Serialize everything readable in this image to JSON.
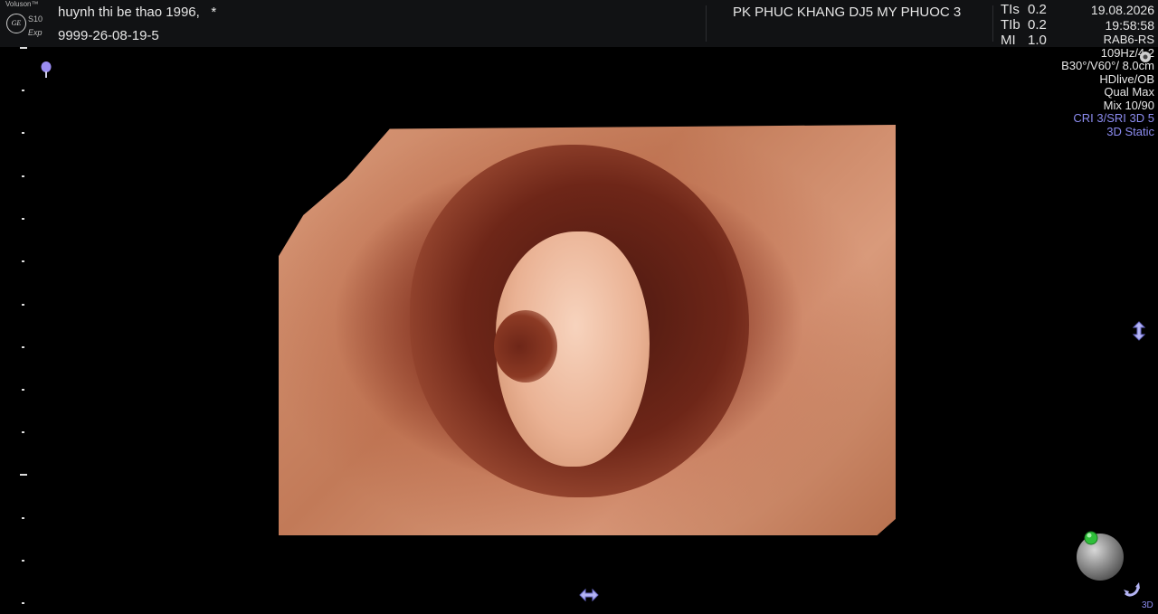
{
  "device": {
    "brand": "Voluson™",
    "logo_text": "GE",
    "model": "S10",
    "edition": "Exp"
  },
  "patient": {
    "name": "huynh thi be thao 1996,",
    "flag": "*",
    "id": "9999-26-08-19-5"
  },
  "hospital": "PK PHUC KHANG DJ5 MY PHUOC 3",
  "indices": [
    {
      "label": "TIs",
      "value": "0.2"
    },
    {
      "label": "TIb",
      "value": "0.2"
    },
    {
      "label": "MI",
      "value": "1.0"
    }
  ],
  "date": "19.08.2026",
  "time": "19:58:58",
  "params": {
    "probe": "RAB6-RS",
    "frequency": "109Hz/4.2",
    "sweep": "B30°/V60°/ 8.0cm",
    "render_mode": "HDlive/OB",
    "quality": "Qual Max",
    "mix": "Mix 10/90",
    "filters": "CRI 3/SRI 3D 5",
    "acquisition": "3D Static"
  },
  "mode_badge": "3D",
  "colors": {
    "accent_blue": "#8c8cf0",
    "orb_green": "#2fbf3a"
  }
}
